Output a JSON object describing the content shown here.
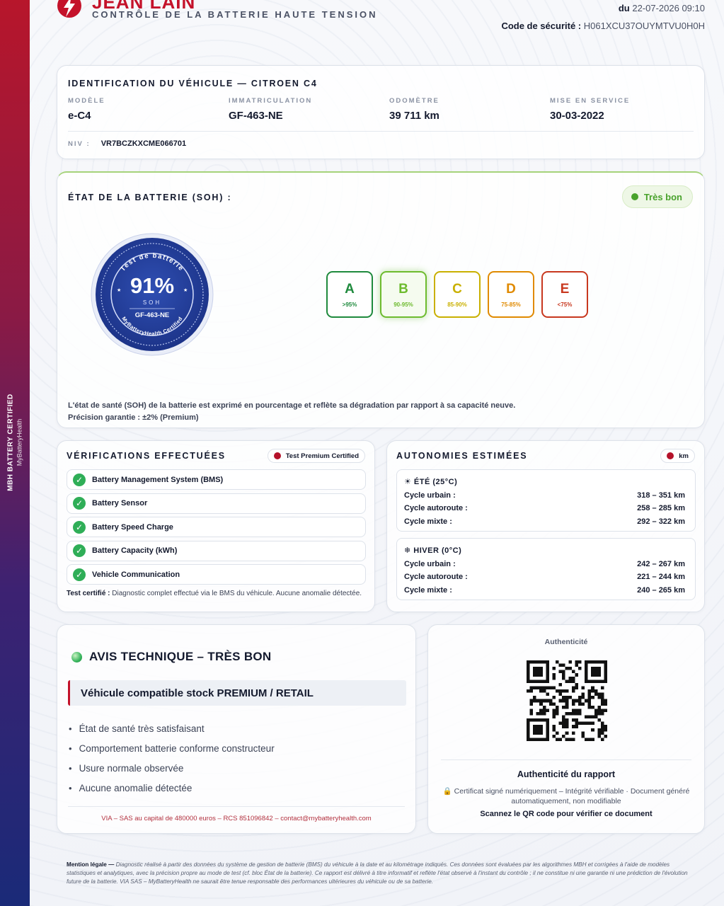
{
  "side": {
    "line1": "MBH BATTERY CERTIFIED",
    "line2": "MyBatteryHealth"
  },
  "header": {
    "brand": "JEAN LAIN",
    "subtitle": "CONTRÔLE DE LA BATTERIE HAUTE TENSION",
    "date_label": "du",
    "date_value": "22-07-2026 09:10",
    "code_label": "Code de sécurité :",
    "code_value": "H061XCU37OUYMTVU0H0H"
  },
  "vehicle": {
    "title": "IDENTIFICATION DU VÉHICULE — CITROEN C4",
    "fields": [
      {
        "label": "MODÈLE",
        "value": "e-C4"
      },
      {
        "label": "IMMATRICULATION",
        "value": "GF-463-NE"
      },
      {
        "label": "ODOMÈTRE",
        "value": "39 711 km"
      },
      {
        "label": "MISE EN SERVICE",
        "value": "30-03-2022"
      }
    ],
    "vin_label": "NIV :",
    "vin_value": "VR7BCZKXCME066701"
  },
  "battery": {
    "title": "ÉTAT DE LA BATTERIE (SOH) :",
    "status": "Très bon",
    "status_color": "#49a22c",
    "seal": {
      "ring_text": "Test de batterie",
      "value": "91%",
      "unit_label": "SOH",
      "plate": "GF-463-NE",
      "bottom_text": "MyBatteryHealth Certified"
    },
    "grades": [
      {
        "letter": "A",
        "range": ">95%",
        "color": "#1f8a3d",
        "active": false
      },
      {
        "letter": "B",
        "range": "90-95%",
        "color": "#6dbb2e",
        "active": true
      },
      {
        "letter": "C",
        "range": "85-90%",
        "color": "#c9b000",
        "active": false
      },
      {
        "letter": "D",
        "range": "75-85%",
        "color": "#e08a00",
        "active": false
      },
      {
        "letter": "E",
        "range": "<75%",
        "color": "#c8381f",
        "active": false
      }
    ],
    "description": "L'état de santé (SOH) de la batterie est exprimé en pourcentage et reflète sa dégradation par rapport à sa capacité neuve.",
    "precision": "Précision garantie : ±2% (Premium)"
  },
  "checks": {
    "title": "VÉRIFICATIONS EFFECTUÉES",
    "badge": "Test Premium Certified",
    "items": [
      "Battery Management System (BMS)",
      "Battery Sensor",
      "Battery Speed Charge",
      "Battery Capacity (kWh)",
      "Vehicle Communication"
    ],
    "note_label": "Test certifié :",
    "note_text": "Diagnostic complet effectué via le BMS du véhicule. Aucune anomalie détectée."
  },
  "autonomy": {
    "title": "AUTONOMIES ESTIMÉES",
    "unit": "km",
    "summer": {
      "title": "☀ ÉTÉ (25°C)",
      "rows": [
        {
          "label": "Cycle urbain :",
          "value": "318 – 351 km"
        },
        {
          "label": "Cycle autoroute :",
          "value": "258 – 285 km"
        },
        {
          "label": "Cycle mixte :",
          "value": "292 – 322 km"
        }
      ]
    },
    "winter": {
      "title": "❄ HIVER (0°C)",
      "rows": [
        {
          "label": "Cycle urbain :",
          "value": "242 – 267 km"
        },
        {
          "label": "Cycle autoroute :",
          "value": "221 – 244 km"
        },
        {
          "label": "Cycle mixte :",
          "value": "240 – 265 km"
        }
      ]
    }
  },
  "notice": {
    "title": "AVIS TECHNIQUE – TRÈS BON",
    "compat": "Véhicule compatible stock PREMIUM / RETAIL",
    "bullets": [
      "État de santé très satisfaisant",
      "Comportement batterie conforme constructeur",
      "Usure normale observée",
      "Aucune anomalie détectée"
    ],
    "footer": "VIA – SAS au capital de 480000 euros – RCS 851096842 – contact@mybatteryhealth.com"
  },
  "auth": {
    "label": "Authenticité",
    "title": "Authenticité du rapport",
    "desc": "🔒 Certificat signé numériquement – Intégrité vérifiable · Document généré automatiquement, non modifiable",
    "scan": "Scannez le QR code pour vérifier ce document"
  },
  "legal": {
    "label": "Mention légale —",
    "text": "Diagnostic réalisé à partir des données du système de gestion de batterie (BMS) du véhicule à la date et au kilométrage indiqués. Ces données sont évaluées par les algorithmes MBH et corrigées à l'aide de modèles statistiques et analytiques, avec la précision propre au mode de test (cf. bloc État de la batterie). Ce rapport est délivré à titre informatif et reflète l'état observé à l'instant du contrôle ; il ne constitue ni une garantie ni une prédiction de l'évolution future de la batterie. VIA SAS – MyBatteryHealth ne saurait être tenue responsable des performances ultérieures du véhicule ou de sa batterie."
  },
  "colors": {
    "brand_red": "#c4122a",
    "check_green": "#2fae57",
    "badge_red": "#b5122a"
  }
}
